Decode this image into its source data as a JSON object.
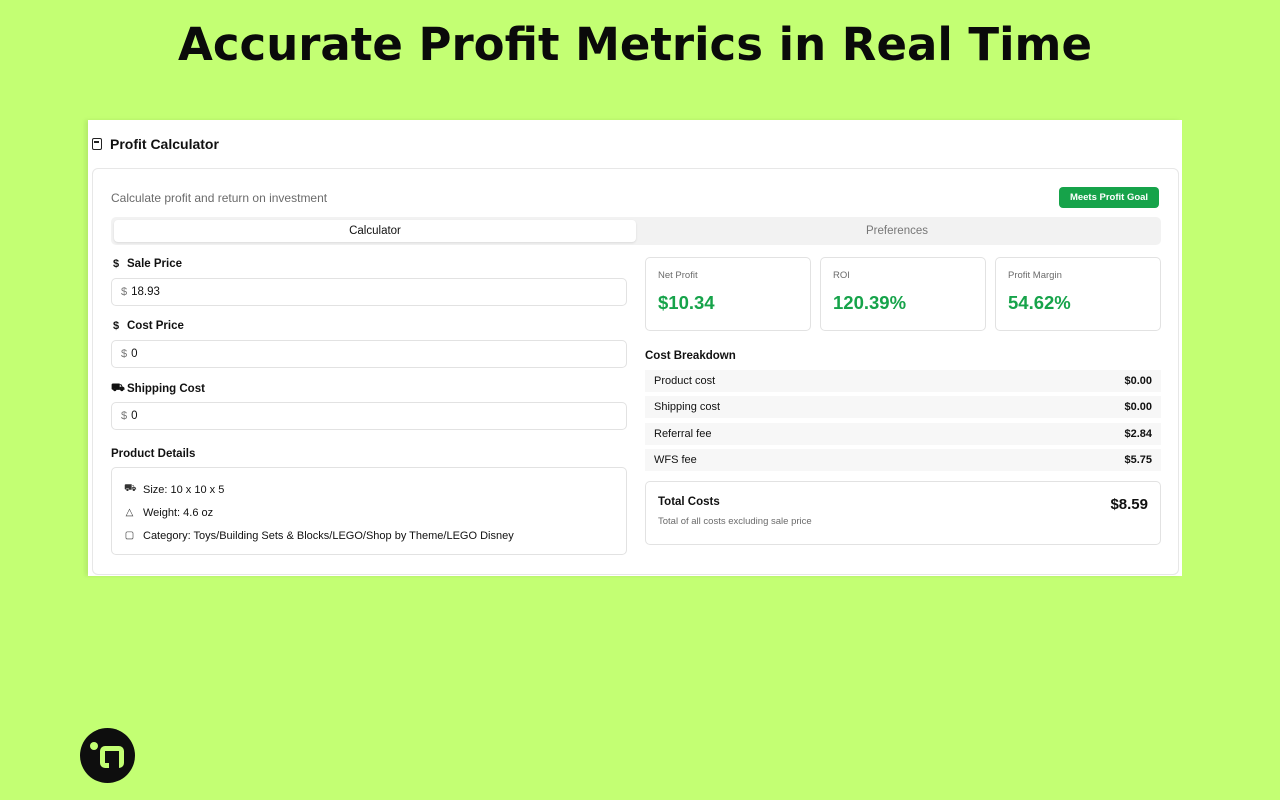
{
  "headline": "Accurate Profit Metrics in Real Time",
  "panel": {
    "title": "Profit Calculator",
    "subtitle": "Calculate profit and return on investment",
    "goal_badge": "Meets Profit Goal",
    "tabs": [
      {
        "label": "Calculator",
        "active": true
      },
      {
        "label": "Preferences",
        "active": false
      }
    ]
  },
  "fields": {
    "sale_price": {
      "label": "Sale Price",
      "currency": "$",
      "value": "18.93",
      "icon": "dollar-icon"
    },
    "cost_price": {
      "label": "Cost Price",
      "currency": "$",
      "value": "0",
      "icon": "dollar-icon"
    },
    "shipping_cost": {
      "label": "Shipping Cost",
      "currency": "$",
      "value": "0",
      "icon": "truck-icon"
    }
  },
  "product_details": {
    "title": "Product Details",
    "size": "Size: 10 x 10 x 5",
    "weight": "Weight: 4.6 oz",
    "category": "Category: Toys/Building Sets & Blocks/LEGO/Shop by Theme/LEGO Disney"
  },
  "metrics": {
    "net_profit": {
      "label": "Net Profit",
      "value": "$10.34"
    },
    "roi": {
      "label": "ROI",
      "value": "120.39%"
    },
    "profit_margin": {
      "label": "Profit Margin",
      "value": "54.62%"
    }
  },
  "cost_breakdown": {
    "title": "Cost Breakdown",
    "rows": [
      {
        "label": "Product cost",
        "value": "$0.00"
      },
      {
        "label": "Shipping cost",
        "value": "$0.00"
      },
      {
        "label": "Referral fee",
        "value": "$2.84"
      },
      {
        "label": "WFS fee",
        "value": "$5.75"
      }
    ]
  },
  "total": {
    "label": "Total Costs",
    "subtitle": "Total of all costs excluding sale price",
    "value": "$8.59"
  },
  "colors": {
    "background": "#c3ff73",
    "accent_green": "#16a34a"
  }
}
